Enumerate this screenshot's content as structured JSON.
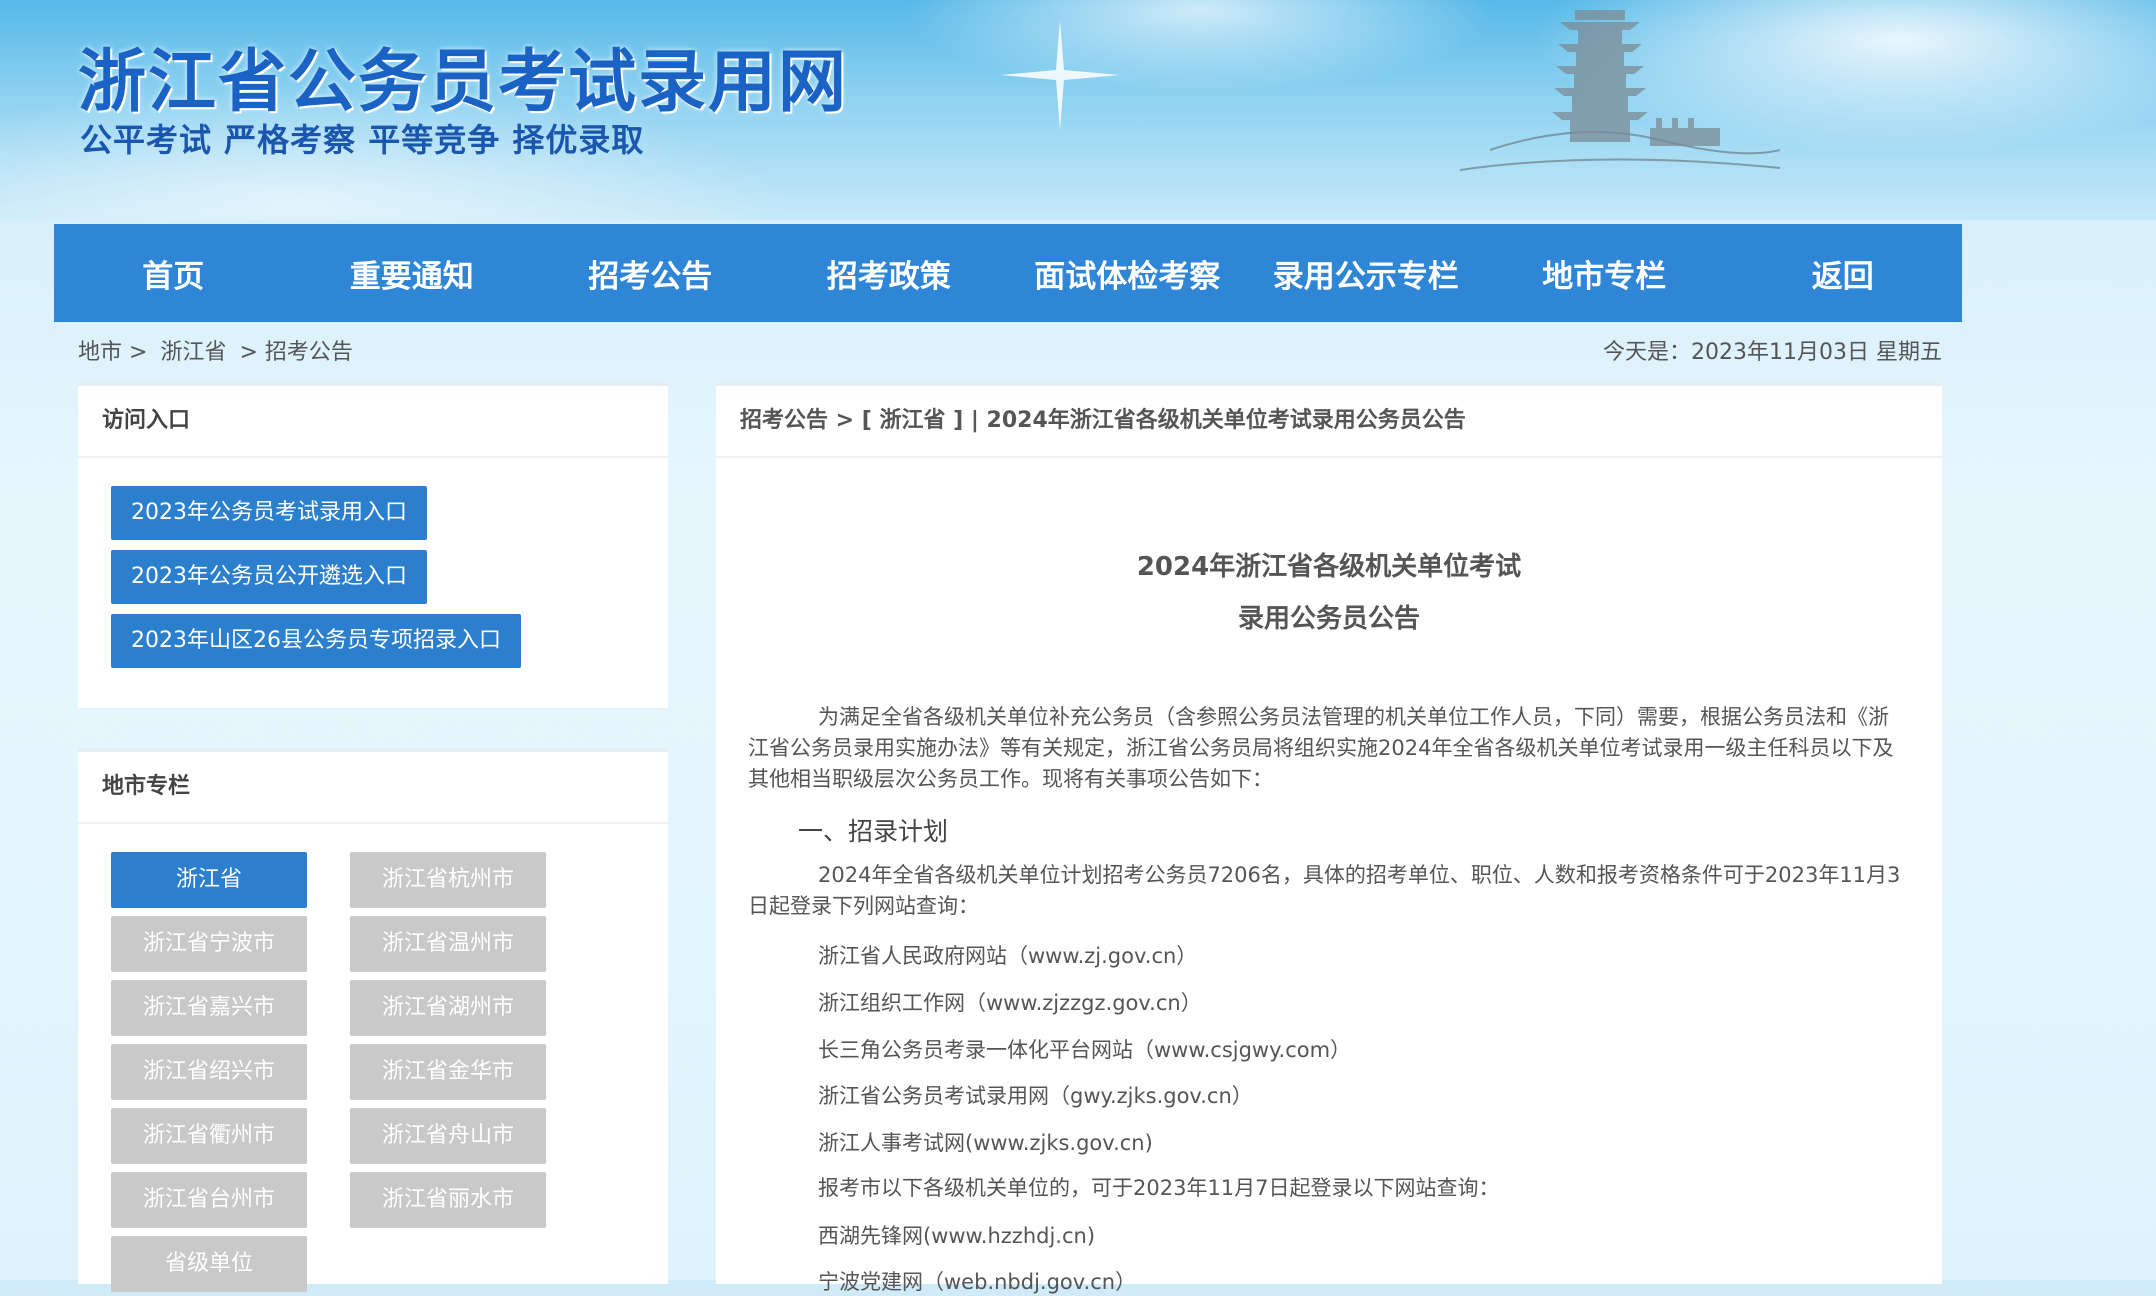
{
  "header": {
    "title": "浙江省公务员考试录用网",
    "slogan": "公平考试 严格考察 平等竞争 择优录取"
  },
  "nav": [
    "首页",
    "重要通知",
    "招考公告",
    "招考政策",
    "面试体检考察",
    "录用公示专栏",
    "地市专栏",
    "返回"
  ],
  "breadcrumb": {
    "items": [
      "地市 >",
      "浙江省",
      "> 招考公告"
    ],
    "date": "今天是：2023年11月03日 星期五"
  },
  "access": {
    "title": "访问入口",
    "buttons": [
      "2023年公务员考试录用入口",
      "2023年公务员公开遴选入口",
      "2023年山区26县公务员专项招录入口"
    ]
  },
  "cities": {
    "title": "地市专栏",
    "items": [
      "浙江省",
      "浙江省杭州市",
      "浙江省宁波市",
      "浙江省温州市",
      "浙江省嘉兴市",
      "浙江省湖州市",
      "浙江省绍兴市",
      "浙江省金华市",
      "浙江省衢州市",
      "浙江省舟山市",
      "浙江省台州市",
      "浙江省丽水市",
      "省级单位"
    ],
    "active": "浙江省"
  },
  "article": {
    "crumb": "招考公告 > [ 浙江省 ] | 2024年浙江省各级机关单位考试录用公务员公告",
    "title_line1": "2024年浙江省各级机关单位考试",
    "title_line2": "录用公务员公告",
    "intro": "为满足全省各级机关单位补充公务员（含参照公务员法管理的机关单位工作人员，下同）需要，根据公务员法和《浙江省公务员录用实施办法》等有关规定，浙江省公务员局将组织实施2024年全省各级机关单位考试录用一级主任科员以下及其他相当职级层次公务员工作。现将有关事项公告如下：",
    "section1": "一、招录计划",
    "plan": "2024年全省各级机关单位计划招考公务员7206名，具体的招考单位、职位、人数和报考资格条件可于2023年11月3日起登录下列网站查询：",
    "sites": [
      "浙江省人民政府网站（www.zj.gov.cn）",
      "浙江组织工作网（www.zjzzgz.gov.cn）",
      "长三角公务员考录一体化平台网站（www.csjgwy.com）",
      "浙江省公务员考试录用网（gwy.zjks.gov.cn）",
      "浙江人事考试网(www.zjks.gov.cn)",
      "报考市以下各级机关单位的，可于2023年11月7日起登录以下网站查询：",
      "西湖先锋网(www.hzzhdj.cn)",
      "宁波党建网（web.nbdj.gov.cn）"
    ]
  },
  "colors": {
    "nav": "#2f86d6",
    "button": "#2b7fcd",
    "title": "#1a62c4"
  }
}
